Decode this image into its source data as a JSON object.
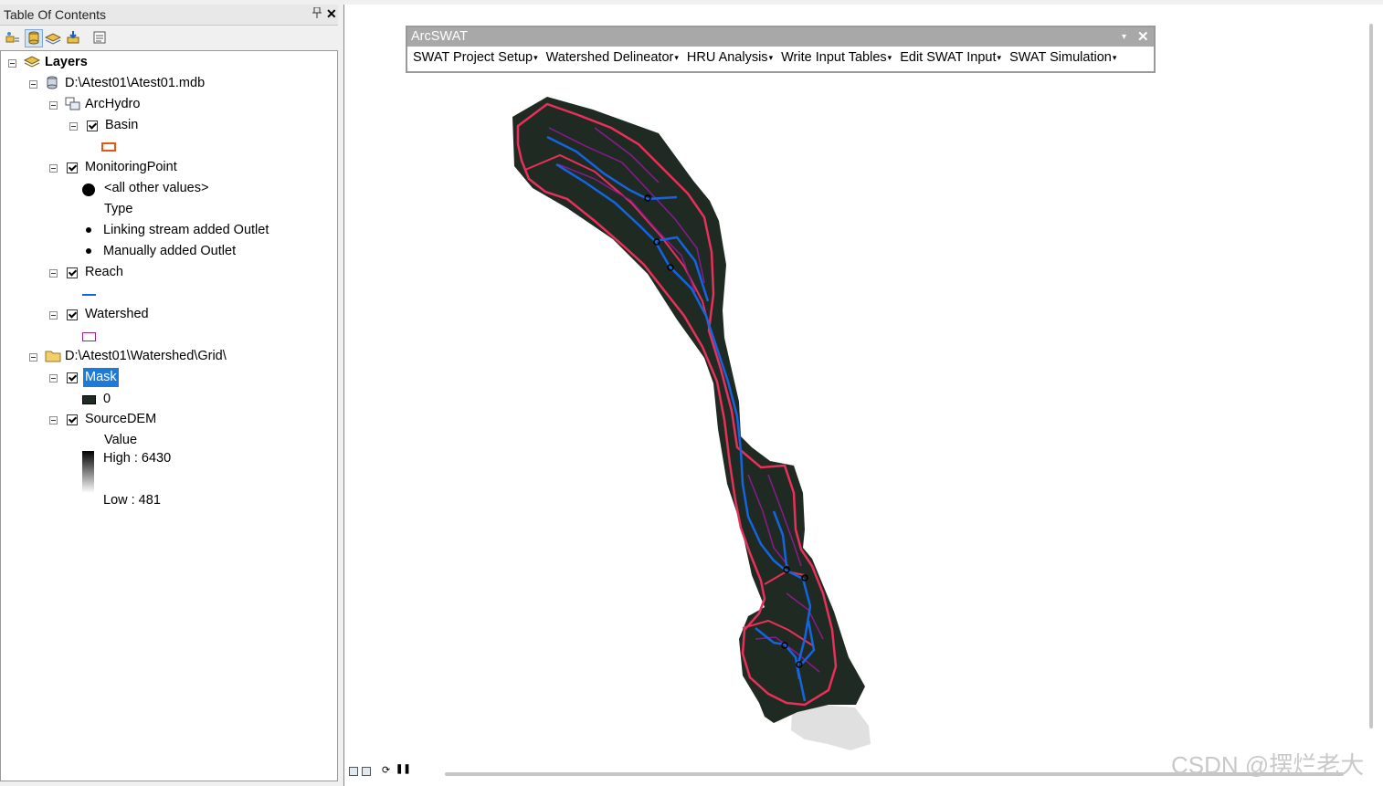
{
  "toc": {
    "title": "Table Of Contents",
    "pin_icon": "pin-icon",
    "close_glyph": "✕",
    "toolbar_icons": [
      "list-by-drawing-order-icon",
      "list-by-source-icon",
      "list-by-visibility-icon",
      "list-by-selection-icon",
      "options-icon"
    ]
  },
  "tree": {
    "layers_label": "Layers",
    "mdb_label": "D:\\Atest01\\Atest01.mdb",
    "archydro_label": "ArcHydro",
    "basin_label": "Basin",
    "monitoring_label": "MonitoringPoint",
    "all_other_values": "<all other values>",
    "type_label": "Type",
    "linking_outlet": "Linking stream added Outlet",
    "manual_outlet": "Manually added Outlet",
    "reach_label": "Reach",
    "watershed_label": "Watershed",
    "grid_folder_label": "D:\\Atest01\\Watershed\\Grid\\",
    "mask_label": "Mask",
    "mask_value": "0",
    "dem_label": "SourceDEM",
    "dem_value_label": "Value",
    "dem_high": "High : 6430",
    "dem_low": "Low : 481"
  },
  "colors": {
    "basin_outline": "#e8560f",
    "reach_line": "#1565e0",
    "watershed_outline": "#a0208f",
    "mask_fill": "#1f2a22",
    "basin_boundary": "#e8305a",
    "selection": "#1e7ad6"
  },
  "arcswat": {
    "title": "ArcSWAT",
    "dropdown_glyph": "▾",
    "close_glyph": "✕",
    "menu": [
      "SWAT Project Setup",
      "Watershed Delineator",
      "HRU Analysis",
      "Write Input Tables",
      "Edit SWAT Input",
      "SWAT Simulation"
    ]
  },
  "watermark": "CSDN @摆烂老大"
}
